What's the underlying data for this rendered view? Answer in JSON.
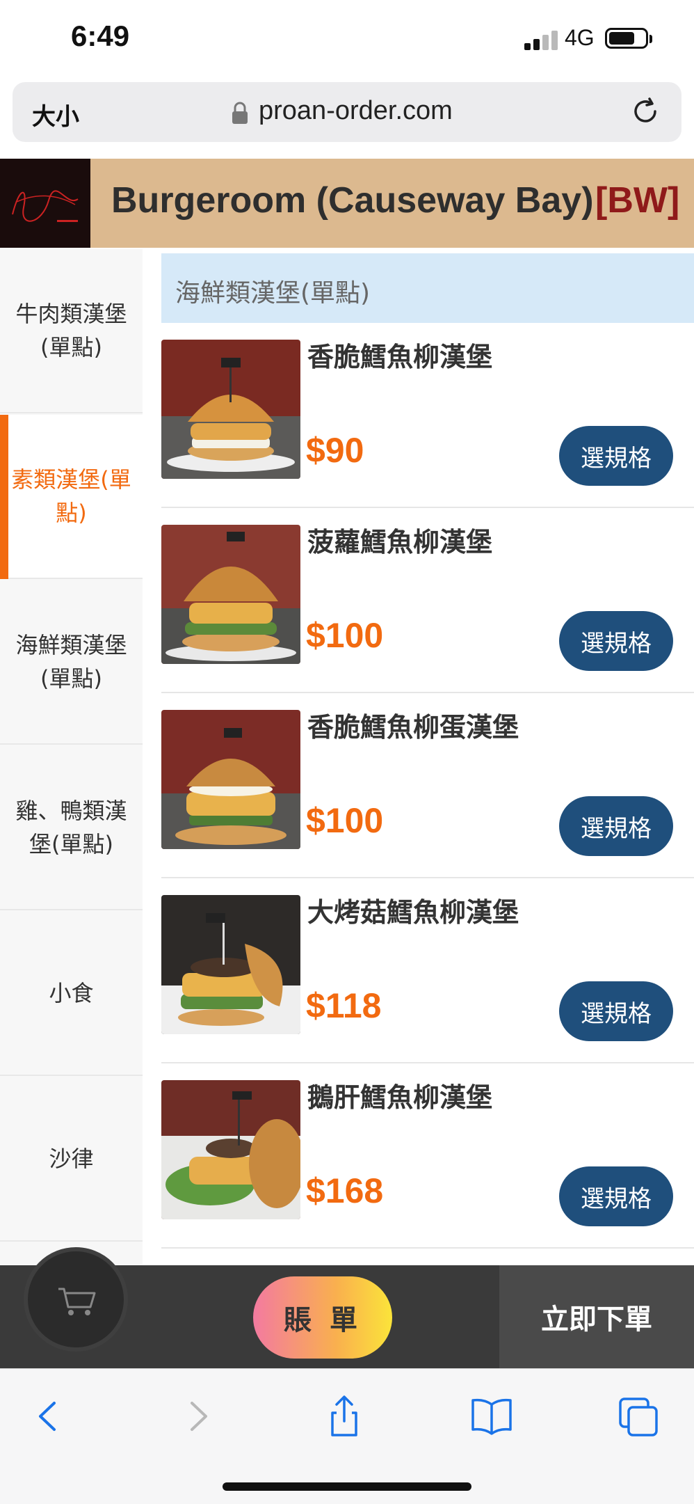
{
  "status_bar": {
    "time": "6:49",
    "network": "4G"
  },
  "browser": {
    "text_size_label": "大小",
    "url": "proan-order.com"
  },
  "store": {
    "title": "Burgeroom (Causeway Bay)",
    "tag": "[BW]"
  },
  "categories": [
    {
      "label": "牛肉類漢堡(單點)",
      "active": false
    },
    {
      "label": "素類漢堡(單點)",
      "active": true
    },
    {
      "label": "海鮮類漢堡(單點)",
      "active": false
    },
    {
      "label": "雞、鴨類漢堡(單點)",
      "active": false
    },
    {
      "label": "小食",
      "active": false
    },
    {
      "label": "沙律",
      "active": false
    }
  ],
  "section": {
    "title": "海鮮類漢堡(單點)"
  },
  "products": [
    {
      "name": "香脆鱈魚柳漢堡",
      "price": "$90",
      "button": "選規格"
    },
    {
      "name": "菠蘿鱈魚柳漢堡",
      "price": "$100",
      "button": "選規格"
    },
    {
      "name": "香脆鱈魚柳蛋漢堡",
      "price": "$100",
      "button": "選規格"
    },
    {
      "name": "大烤菇鱈魚柳漢堡",
      "price": "$118",
      "button": "選規格"
    },
    {
      "name": "鵝肝鱈魚柳漢堡",
      "price": "$168",
      "button": "選規格"
    }
  ],
  "bottom_bar": {
    "bill_label": "賬 單",
    "order_label": "立即下單"
  },
  "colors": {
    "accent": "#f26a10",
    "button": "#1f4f7c",
    "header": "#dcb98f",
    "section": "#d6e9f8"
  },
  "icons": [
    "lock-icon",
    "reload-icon",
    "cart-icon",
    "back-icon",
    "forward-icon",
    "share-icon",
    "bookmarks-icon",
    "tabs-icon"
  ]
}
